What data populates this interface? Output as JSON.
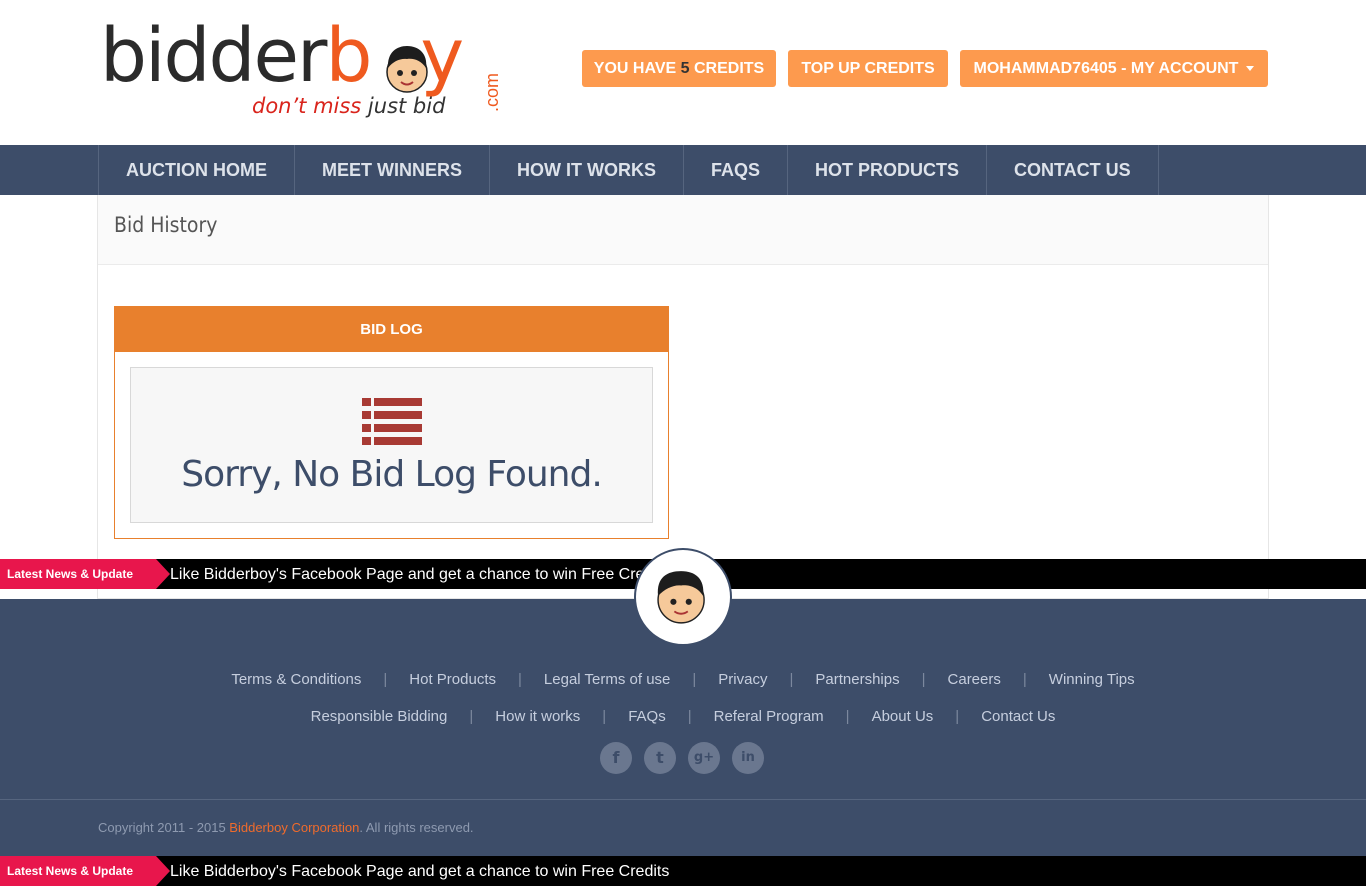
{
  "header": {
    "logo": {
      "word_dark": "bidder",
      "word_orange_1": "b",
      "word_orange_2": "y",
      "dotcom": ".com",
      "tagline_red": "don’t miss ",
      "tagline_dark": "just bid"
    },
    "credits_button": {
      "prefix": "YOU HAVE ",
      "count": "5",
      "suffix": " CREDITS"
    },
    "topup_label": "TOP UP CREDITS",
    "account_label": "MOHAMMAD76405 - MY ACCOUNT"
  },
  "nav": {
    "items": [
      {
        "label": "AUCTION HOME"
      },
      {
        "label": "MEET WINNERS"
      },
      {
        "label": "HOW IT WORKS"
      },
      {
        "label": "FAQS"
      },
      {
        "label": "HOT PRODUCTS"
      },
      {
        "label": "CONTACT US"
      }
    ]
  },
  "page": {
    "title": "Bid History",
    "bidlog": {
      "heading": "BID LOG",
      "icon": "list-icon",
      "empty_message": "Sorry, No Bid Log Found."
    }
  },
  "ticker": {
    "label": "Latest News & Update",
    "message": "Like Bidderboy's Facebook Page and get a chance to win Free Credits"
  },
  "footer": {
    "links_row1": [
      "Terms & Conditions",
      "Hot Products",
      "Legal Terms of use",
      "Privacy",
      "Partnerships",
      "Careers",
      "Winning Tips"
    ],
    "links_row2": [
      "Responsible Bidding",
      "How it works",
      "FAQs",
      "Referal Program",
      "About Us",
      "Contact Us"
    ],
    "socials": [
      {
        "icon": "facebook-icon",
        "glyph": "f"
      },
      {
        "icon": "twitter-icon",
        "glyph": "t"
      },
      {
        "icon": "google-plus-icon",
        "glyph": "g+"
      },
      {
        "icon": "linkedin-icon",
        "glyph": "in"
      }
    ],
    "copyright_prefix": "Copyright 2011 - 2015 ",
    "copyright_corp": "Bidderboy Corporation",
    "copyright_suffix": ". All rights reserved."
  },
  "colors": {
    "accent_orange": "#fd9a4e",
    "bidlog_orange": "#e8802d",
    "nav_bg": "#3d4d69",
    "ticker_red": "#e8164c",
    "icon_red": "#a83a34"
  }
}
